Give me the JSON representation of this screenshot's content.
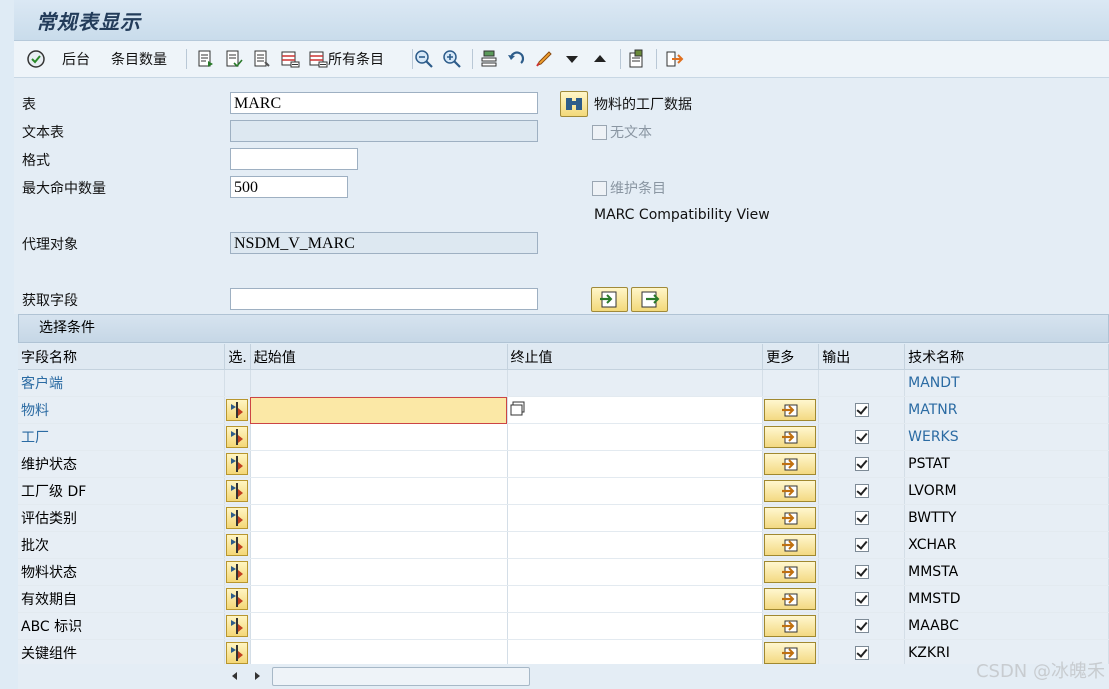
{
  "window": {
    "title": "常规表显示"
  },
  "toolbar": {
    "background_label": "后台",
    "entry_count_label": "条目数量",
    "all_entries_label": "所有条目"
  },
  "form": {
    "table_label": "表",
    "table_value": "MARC",
    "table_desc": "物料的工厂数据",
    "text_table_label": "文本表",
    "text_table_value": "",
    "no_text_label": "无文本",
    "format_label": "格式",
    "format_value": "",
    "max_hits_label": "最大命中数量",
    "max_hits_value": "500",
    "maintain_entries_label": "维护条目",
    "compat_view_text": "MARC Compatibility View",
    "proxy_label": "代理对象",
    "proxy_value": "NSDM_V_MARC",
    "fetch_field_label": "获取字段",
    "fetch_field_value": ""
  },
  "selection": {
    "header": "选择条件",
    "columns": [
      "字段名称",
      "选.",
      "起始值",
      "终止值",
      "更多",
      "输出",
      "技术名称"
    ],
    "rows": [
      {
        "name": "客户端",
        "tech": "MANDT",
        "link": true,
        "has_controls": false
      },
      {
        "name": "物料",
        "tech": "MATNR",
        "link": true,
        "has_controls": true,
        "active": true
      },
      {
        "name": "工厂",
        "tech": "WERKS",
        "link": true,
        "has_controls": true
      },
      {
        "name": "维护状态",
        "tech": "PSTAT",
        "link": false,
        "has_controls": true
      },
      {
        "name": "工厂级 DF",
        "tech": "LVORM",
        "link": false,
        "has_controls": true
      },
      {
        "name": "评估类别",
        "tech": "BWTTY",
        "link": false,
        "has_controls": true
      },
      {
        "name": "批次",
        "tech": "XCHAR",
        "link": false,
        "has_controls": true
      },
      {
        "name": "物料状态",
        "tech": "MMSTA",
        "link": false,
        "has_controls": true
      },
      {
        "name": "有效期自",
        "tech": "MMSTD",
        "link": false,
        "has_controls": true
      },
      {
        "name": "ABC 标识",
        "tech": "MAABC",
        "link": false,
        "has_controls": true
      },
      {
        "name": "关键组件",
        "tech": "KZKRI",
        "link": false,
        "has_controls": true
      }
    ]
  },
  "watermark": "CSDN @冰魄禾"
}
